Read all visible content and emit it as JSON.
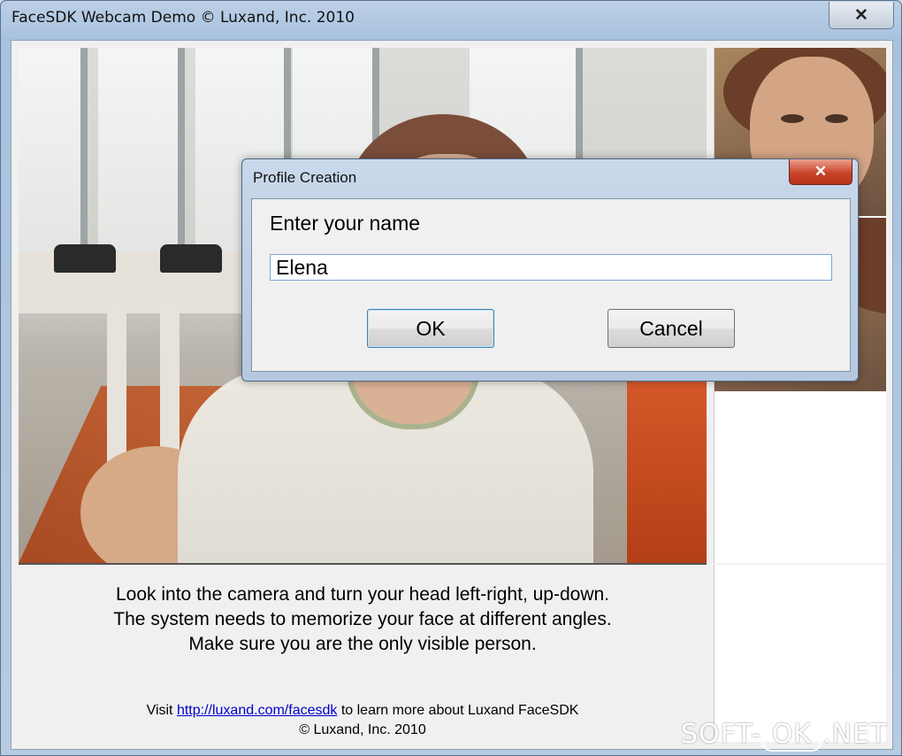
{
  "window": {
    "title": "FaceSDK Webcam Demo © Luxand, Inc. 2010",
    "close_glyph": "✕"
  },
  "instructions": {
    "line1": "Look into the camera and turn your head left-right, up-down.",
    "line2": "The system needs to memorize your face at different angles.",
    "line3": "Make sure you are the only visible person."
  },
  "footer": {
    "prefix": "Visit ",
    "link_text": "http://luxand.com/facesdk",
    "suffix": " to learn more about Luxand FaceSDK",
    "copyright": "© Luxand, Inc. 2010"
  },
  "dialog": {
    "title": "Profile Creation",
    "close_glyph": "✕",
    "prompt": "Enter your name",
    "name_value": "Elena",
    "ok_label": "OK",
    "cancel_label": "Cancel"
  },
  "watermark": {
    "left": "SOFT-",
    "middle": "OK",
    "right": ".NET"
  }
}
